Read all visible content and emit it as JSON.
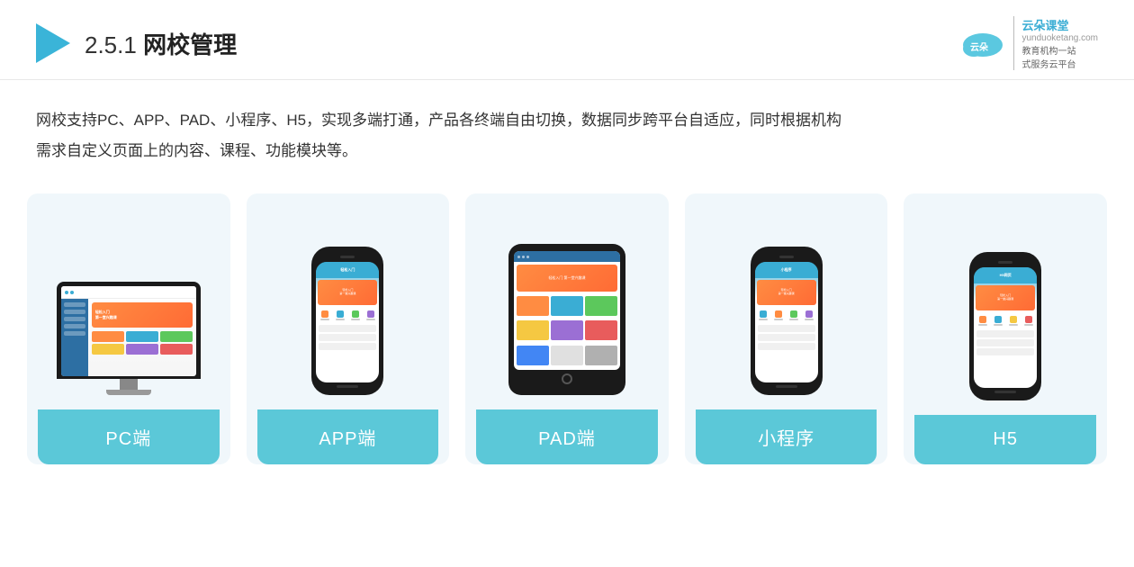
{
  "header": {
    "section_number": "2.5.1",
    "title_normal": "网校管理",
    "title_bold": "网校管理"
  },
  "brand": {
    "name": "云朵课堂",
    "url": "yunduoketang.com",
    "slogan_line1": "教育机构一站",
    "slogan_line2": "式服务云平台"
  },
  "description": {
    "text_line1": "网校支持PC、APP、PAD、小程序、H5，实现多端打通，产品各终端自由切换，数据同步跨平台自适应，同时根据机构",
    "text_line2": "需求自定义页面上的内容、课程、功能模块等。"
  },
  "cards": [
    {
      "id": "pc",
      "label": "PC端",
      "device_type": "monitor"
    },
    {
      "id": "app",
      "label": "APP端",
      "device_type": "phone"
    },
    {
      "id": "pad",
      "label": "PAD端",
      "device_type": "tablet"
    },
    {
      "id": "miniprogram",
      "label": "小程序",
      "device_type": "phone"
    },
    {
      "id": "h5",
      "label": "H5",
      "device_type": "phone"
    }
  ]
}
